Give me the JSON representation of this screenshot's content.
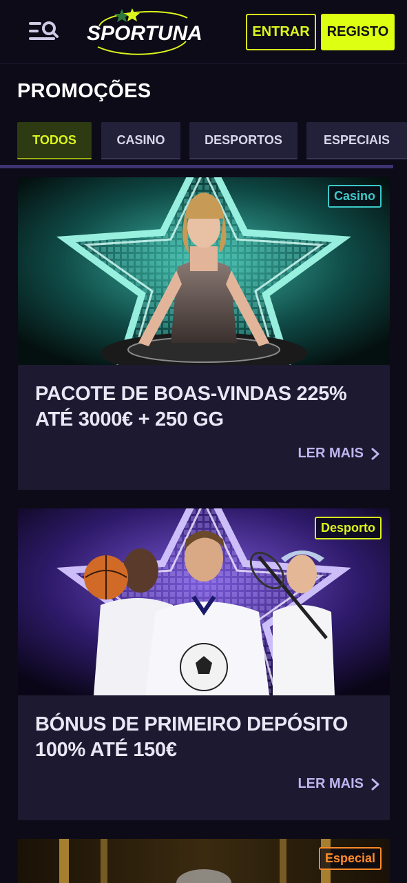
{
  "header": {
    "logo_text": "SPORTUNA",
    "login_label": "ENTRAR",
    "register_label": "REGISTO"
  },
  "page": {
    "title": "PROMOÇÕES"
  },
  "tabs": [
    {
      "label": "TODOS",
      "active": true
    },
    {
      "label": "CASINO",
      "active": false
    },
    {
      "label": "DESPORTOS",
      "active": false
    },
    {
      "label": "ESPECIAIS",
      "active": false
    }
  ],
  "promotions": [
    {
      "badge": "Casino",
      "badge_color": "#3cc9c9",
      "title": "PACOTE DE BOAS-VINDAS 225% ATÉ 3000€ + 250 GG",
      "read_more": "LER MAIS"
    },
    {
      "badge": "Desporto",
      "badge_color": "#dcf51b",
      "title": "BÓNUS DE PRIMEIRO DEPÓSITO 100% ATÉ 150€",
      "read_more": "LER MAIS"
    },
    {
      "badge": "Especial",
      "badge_color": "#ff8a2a"
    }
  ],
  "colors": {
    "accent": "#dcf51b",
    "background": "#0d0b18",
    "card": "#1c1930",
    "link": "#bfb5f0"
  }
}
